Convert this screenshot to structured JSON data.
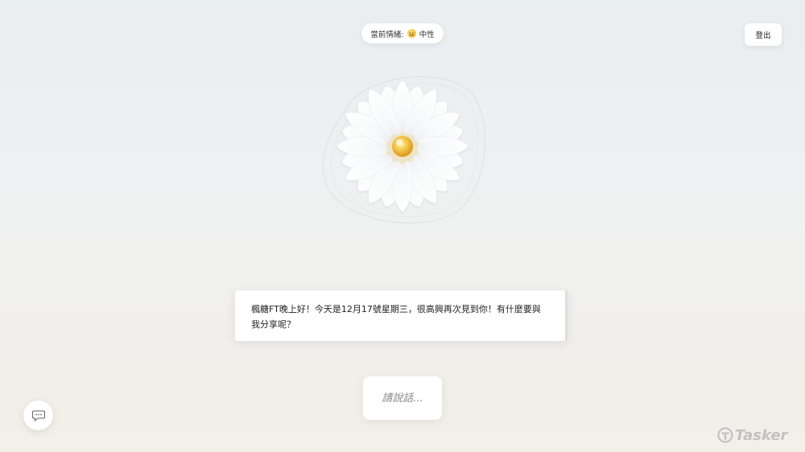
{
  "header": {
    "emotion_label": "當前情緒:",
    "emotion_icon": "neutral-face-emoji-icon",
    "emotion_value": "中性",
    "logout_label": "登出"
  },
  "message": {
    "text": "楓糖FT晚上好！今天是12月17號星期三，很高興再次見到你！有什麼要與我分享呢？"
  },
  "input": {
    "placeholder": "請說話..."
  },
  "chat_button": {
    "icon": "chat-bubble-icon"
  },
  "watermark": {
    "icon": "tasker-logo-icon",
    "text": "Tasker"
  },
  "colors": {
    "background_top": "#e9eef1",
    "background_bottom": "#f3efe9",
    "flower_center": "#f5c23a",
    "watermark": "#c2c2c2"
  }
}
